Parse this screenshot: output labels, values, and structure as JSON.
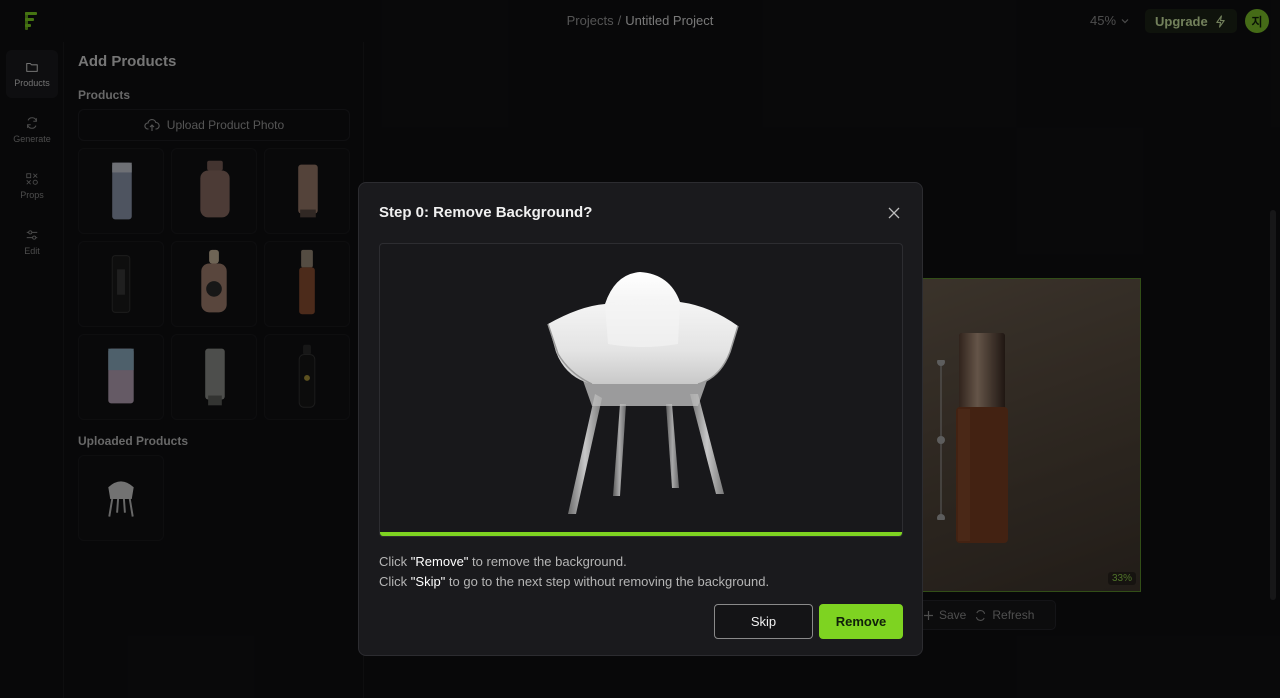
{
  "topbar": {
    "breadcrumb_root": "Projects",
    "breadcrumb_sep": "/",
    "breadcrumb_current": "Untitled Project",
    "zoom": "45%",
    "upgrade_label": "Upgrade",
    "avatar_initial": "지"
  },
  "rail": {
    "items": [
      {
        "label": "Products",
        "icon": "folder-icon"
      },
      {
        "label": "Generate",
        "icon": "refresh-icon"
      },
      {
        "label": "Props",
        "icon": "props-icon"
      },
      {
        "label": "Edit",
        "icon": "sliders-icon"
      }
    ]
  },
  "panel": {
    "title": "Add Products",
    "products_label": "Products",
    "upload_label": "Upload Product Photo",
    "uploaded_label": "Uploaded Products",
    "products": [
      {
        "name": "tube-light"
      },
      {
        "name": "bottle-brown"
      },
      {
        "name": "tube-tan"
      },
      {
        "name": "tube-black"
      },
      {
        "name": "dropper-bottle"
      },
      {
        "name": "serum-tall"
      },
      {
        "name": "tube-pink"
      },
      {
        "name": "tube-grey"
      },
      {
        "name": "water-bottle-black"
      }
    ],
    "uploaded": [
      {
        "name": "chair"
      }
    ]
  },
  "preview": {
    "percent": "33%",
    "save_label": "Save",
    "refresh_label": "Refresh"
  },
  "modal": {
    "title": "Step 0: Remove Background?",
    "line1_pre": "Click ",
    "line1_key": "\"Remove\"",
    "line1_post": " to remove the background.",
    "line2_pre": "Click ",
    "line2_key": "\"Skip\"",
    "line2_post": " to go to the next step without removing the background.",
    "skip_label": "Skip",
    "remove_label": "Remove",
    "progress": 1.0
  },
  "colors": {
    "accent": "#7ed321",
    "background": "#101012",
    "modal_bg": "#1a1a1d"
  }
}
